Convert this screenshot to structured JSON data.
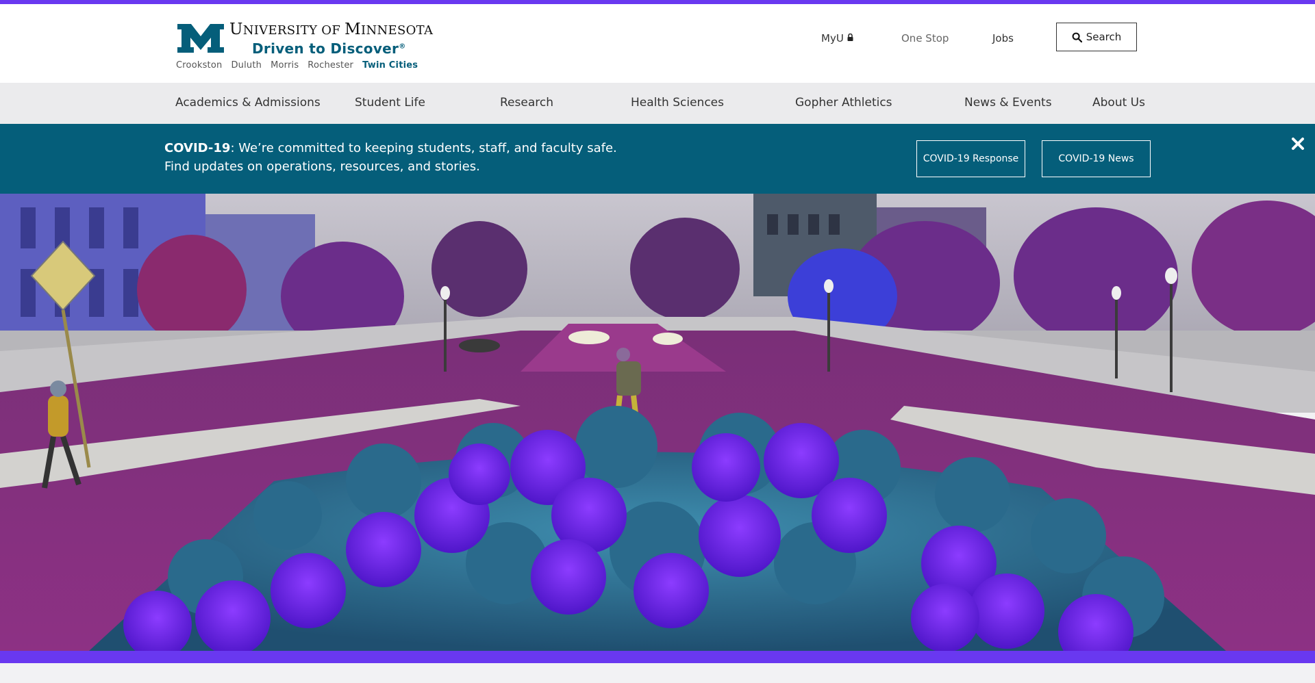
{
  "header": {
    "university_name_first": "U",
    "university_name_rest": "NIVERSITY OF ",
    "university_name_m": "M",
    "university_name_end": "INNESOTA",
    "tagline": "Driven to Discover",
    "tagline_mark": "®",
    "campuses": [
      "Crookston",
      "Duluth",
      "Morris",
      "Rochester",
      "Twin Cities"
    ],
    "active_campus": "Twin Cities",
    "utility_links": {
      "myu": "MyU",
      "one_stop": "One Stop",
      "jobs": "Jobs"
    },
    "search_label": "Search"
  },
  "nav": {
    "items": [
      "Academics & Admissions",
      "Student Life",
      "Research",
      "Health Sciences",
      "Gopher Athletics",
      "News & Events",
      "About Us"
    ]
  },
  "covid_banner": {
    "heading": "COVID-19",
    "line1": ": We’re committed to keeping students, staff, and faculty safe.",
    "line2": "Find updates on operations, resources, and stories.",
    "buttons": [
      "COVID-19 Response",
      "COVID-19 News"
    ]
  },
  "icons": {
    "lock": "lock-icon",
    "search": "search-icon",
    "close": "close-icon",
    "logo": "block-m-logo"
  },
  "colors": {
    "accent_stripe": "#6938f0",
    "brand_teal": "#055e7a",
    "nav_background": "#ebebed",
    "page_background": "#f2f2f4"
  }
}
